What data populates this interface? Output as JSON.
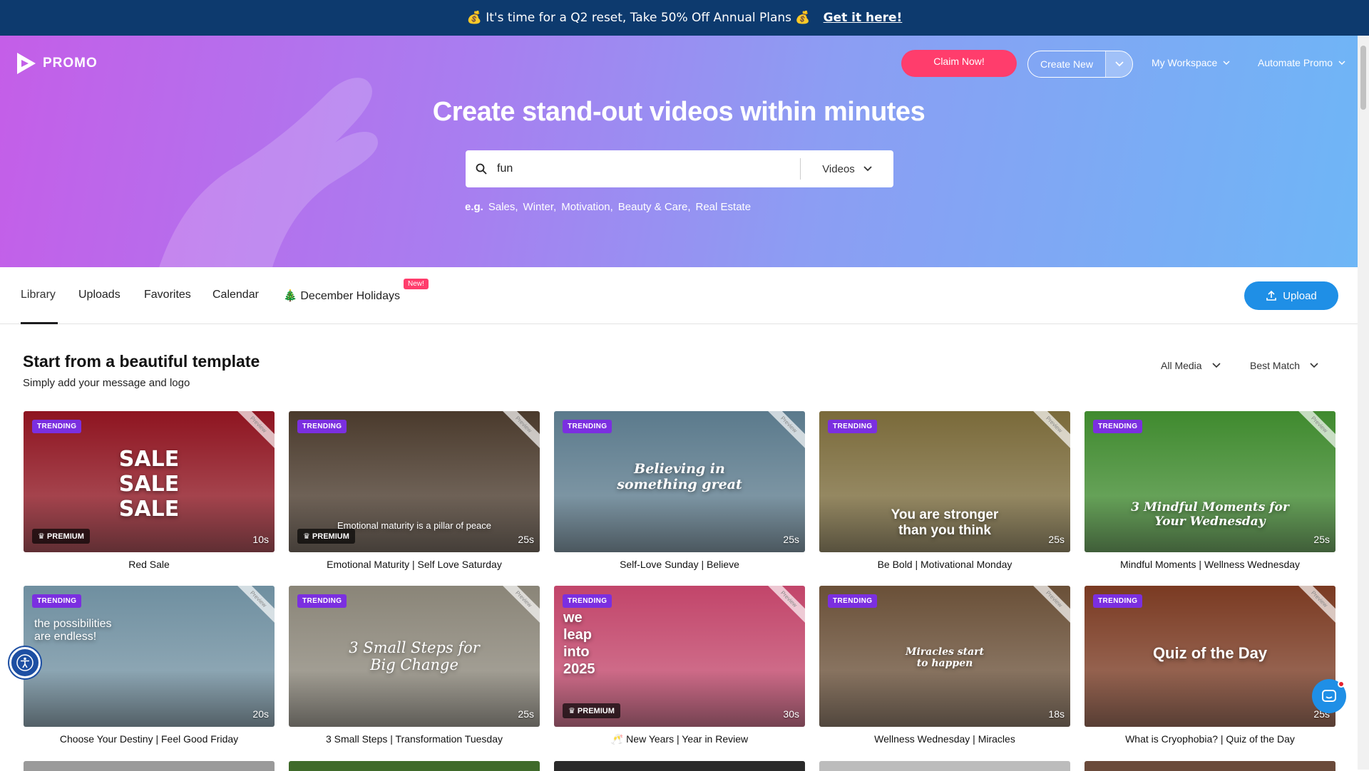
{
  "promo_bar": {
    "text": "💰 It's time for a Q2 reset, Take 50% Off Annual Plans 💰",
    "link": "Get it here!"
  },
  "header": {
    "logo": "PROMO",
    "claim_button": "Claim Now!",
    "create_button": "Create New",
    "workspace": "My Workspace",
    "automate": "Automate Promo"
  },
  "hero": {
    "title": "Create stand-out videos within minutes",
    "search_value": "fun",
    "search_type": "Videos",
    "examples_label": "e.g.",
    "examples": [
      "Sales,",
      "Winter,",
      "Motivation,",
      "Beauty & Care,",
      "Real Estate"
    ]
  },
  "tabs": {
    "items": [
      "Library",
      "Uploads",
      "Favorites",
      "Calendar",
      "🎄 December Holidays"
    ],
    "new_badge": "New!",
    "upload": "Upload"
  },
  "section": {
    "title": "Start from a beautiful template",
    "subtitle": "Simply add your message and logo",
    "filter_media": "All Media",
    "filter_sort": "Best Match"
  },
  "labels": {
    "trending": "TRENDING",
    "premium": "♛ PREMIUM",
    "preview": "Preview"
  },
  "cards": [
    {
      "title": "Red Sale",
      "duration": "10s",
      "overlay": "SALE\nSALE\nSALE",
      "premium": true,
      "bg": "#8e1420"
    },
    {
      "title": "Emotional Maturity | Self Love Saturday",
      "duration": "25s",
      "overlay": "Emotional maturity is a pillar of peace",
      "premium": true,
      "bg": "#4a3a2c"
    },
    {
      "title": "Self-Love Sunday | Believe",
      "duration": "25s",
      "overlay": "Believing in\nsomething great",
      "premium": false,
      "bg": "#5b7a8c"
    },
    {
      "title": "Be Bold | Motivational Monday",
      "duration": "25s",
      "overlay": "You are stronger\nthan you think",
      "premium": false,
      "bg": "#7a6a3a"
    },
    {
      "title": "Mindful Moments | Wellness Wednesday",
      "duration": "25s",
      "overlay": "3 Mindful Moments for\nYour Wednesday",
      "premium": false,
      "bg": "#3f8a2e"
    },
    {
      "title": "Choose Your Destiny | Feel Good Friday",
      "duration": "20s",
      "overlay": "the possibilities\nare endless!",
      "premium": false,
      "bg": "#6f8fa0"
    },
    {
      "title": "3 Small Steps | Transformation Tuesday",
      "duration": "25s",
      "overlay": "3 Small Steps for\nBig Change",
      "premium": false,
      "bg": "#8a8578"
    },
    {
      "title": "🥂 New Years | Year in Review",
      "duration": "30s",
      "overlay": "we\nleap\ninto\n2025",
      "premium": true,
      "bg": "#c2456a"
    },
    {
      "title": "Wellness Wednesday | Miracles",
      "duration": "18s",
      "overlay": "Miracles start\nto happen",
      "premium": false,
      "bg": "#6a5038"
    },
    {
      "title": "What is Cryophobia? | Quiz of the Day",
      "duration": "25s",
      "overlay": "Quiz of the Day",
      "premium": false,
      "bg": "#7a3a22"
    }
  ],
  "bottom_row_colors": [
    "#9a9a9a",
    "#3f6a2a",
    "#2a2a2a",
    "#bcbcbc",
    "#6a4a3a"
  ]
}
